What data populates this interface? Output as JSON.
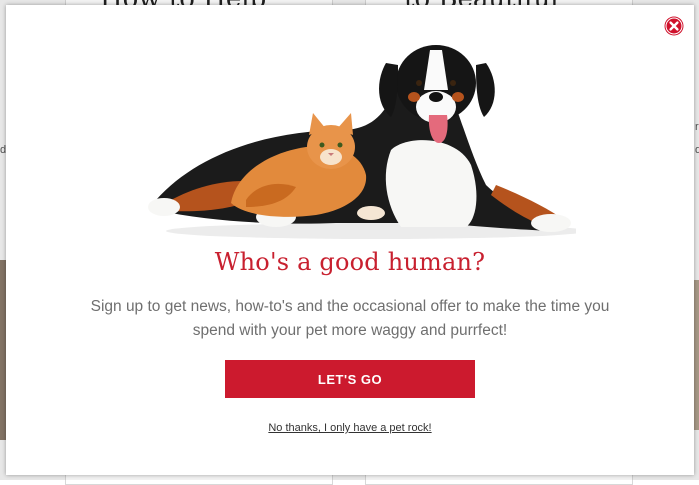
{
  "background_page": {
    "heading_left": "How to Help",
    "heading_right": "to Beautiful",
    "fragment_1": "d",
    "fragment_2": "r",
    "fragment_3": "d"
  },
  "modal": {
    "close_icon": "close-icon",
    "hero_image": "dog-and-cat-image",
    "headline": "Who's a good human?",
    "subtext": "Sign up to get news, how-to's and the occasional offer to make the time you spend with your pet more waggy and purrfect!",
    "cta_label": "LET'S GO",
    "decline_link": "No thanks, I only have a pet rock!"
  },
  "colors": {
    "brand_red": "#cc1a2e",
    "headline_red": "#c8202f",
    "close_red": "#d0122c"
  }
}
